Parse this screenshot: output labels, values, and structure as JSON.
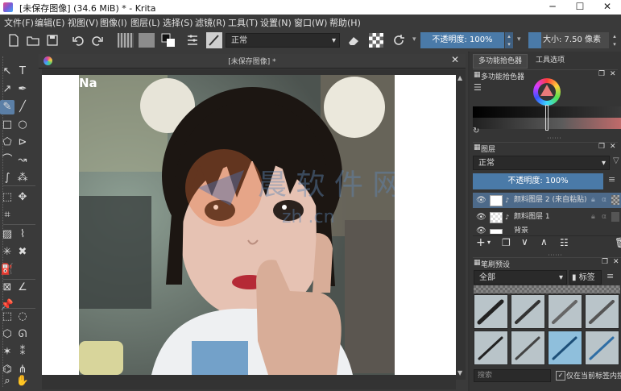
{
  "titlebar": {
    "title": "[未保存图像]  (34.6 MiB)  * - Krita",
    "minimize": "─",
    "maximize": "☐",
    "close": "✕"
  },
  "menu": [
    "文件(F)",
    "编辑(E)",
    "视图(V)",
    "图像(I)",
    "图层(L)",
    "选择(S)",
    "滤镜(R)",
    "工具(T)",
    "设置(N)",
    "窗口(W)",
    "帮助(H)"
  ],
  "toolbar": {
    "blend_mode": "正常",
    "opacity_label": "不透明度: 100%",
    "size_label": "大小: 7.50 像素"
  },
  "document": {
    "tab_title": "[未保存图像]  *",
    "photo_tag": "Na",
    "watermark_main": "晨 软 件 网",
    "watermark_url": "zh .cn"
  },
  "docker": {
    "tabs": [
      "多功能拾色器",
      "工具选项"
    ],
    "color_selector_title": "多功能拾色器",
    "layers_title": "图层",
    "layer_blend": "正常",
    "layer_opacity": "不透明度: 100%",
    "layers": [
      {
        "name": "颜料图层 2 (来自粘贴)",
        "selected": true
      },
      {
        "name": "颜料图层 1",
        "selected": false
      },
      {
        "name": "背景",
        "selected": false
      }
    ],
    "brush_title": "笔刷预设",
    "brush_filter": "全部",
    "brush_tag": "标签",
    "search_placeholder": "搜索",
    "only_current_tag": "仅在当前标签内搜"
  },
  "colors": {
    "accent": "#5b7fa6",
    "panel": "#353535",
    "menu_bg": "#3a3a3a"
  }
}
